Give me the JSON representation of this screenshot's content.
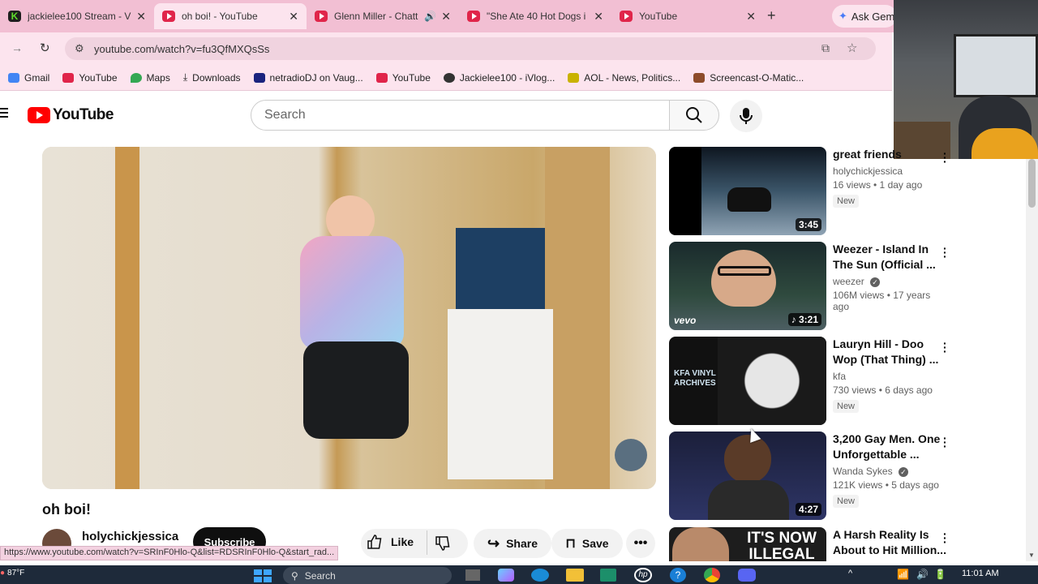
{
  "tabs": [
    {
      "title": "jackielee100 Stream - V",
      "icon": "kick-icon",
      "active": false
    },
    {
      "title": "oh boi! - YouTube",
      "icon": "youtube-icon",
      "active": true
    },
    {
      "title": "Glenn Miller - Chatt",
      "icon": "youtube-icon",
      "active": false
    },
    {
      "title": "\"She Ate 40 Hot Dogs i",
      "icon": "youtube-icon",
      "active": false
    },
    {
      "title": "YouTube",
      "icon": "youtube-icon",
      "active": false
    }
  ],
  "gemini_label": "Ask Gem",
  "url": "youtube.com/watch?v=fu3QfMXQsSs",
  "bookmarks": [
    {
      "label": "Gmail",
      "color": "#4285f4"
    },
    {
      "label": "YouTube",
      "color": "#e0254a"
    },
    {
      "label": "Maps",
      "color": "#34a853"
    },
    {
      "label": "Downloads",
      "color": "#444444"
    },
    {
      "label": "netradioDJ on Vaug...",
      "color": "#1a237e"
    },
    {
      "label": "YouTube",
      "color": "#e0254a"
    },
    {
      "label": "Jackielee100 - iVlog...",
      "color": "#333333"
    },
    {
      "label": "AOL - News, Politics...",
      "color": "#c9b200"
    },
    {
      "label": "Screencast-O-Matic...",
      "color": "#8d4b2a"
    }
  ],
  "youtube": {
    "logo": "YouTube",
    "search_placeholder": "Search"
  },
  "video": {
    "title": "oh boi!",
    "channel": "holychickjessica",
    "subscribe": "Subscribe",
    "like": "Like",
    "share": "Share",
    "save": "Save"
  },
  "recommendations": [
    {
      "title": "great friends",
      "channel": "holychickjessica",
      "meta": "16 views • 1 day ago",
      "badge": "New",
      "duration": "3:45",
      "verified": false
    },
    {
      "title": "Weezer - Island In The Sun (Official ...",
      "channel": "weezer",
      "meta": "106M views • 17 years ago",
      "badge": "",
      "duration": "3:21",
      "verified": true,
      "overlay": "vevo"
    },
    {
      "title": "Lauryn Hill - Doo Wop (That Thing) ...",
      "channel": "kfa",
      "meta": "730 views • 6 days ago",
      "badge": "New",
      "duration": "",
      "verified": false,
      "overlay": "KFA VINYL ARCHIVES"
    },
    {
      "title": "3,200 Gay Men. One Unforgettable ...",
      "channel": "Wanda Sykes",
      "meta": "121K views • 5 days ago",
      "badge": "New",
      "duration": "4:27",
      "verified": true
    },
    {
      "title": "A Harsh Reality Is About to Hit Million...",
      "channel": "",
      "meta": "",
      "badge": "",
      "duration": "",
      "verified": false,
      "overlay": "IT'S NOW ILLEGAL"
    }
  ],
  "status_url": "https://www.youtube.com/watch?v=SRInF0Hlo-Q&list=RDSRInF0Hlo-Q&start_rad...",
  "taskbar": {
    "weather": "87°F",
    "search": "Search",
    "time": "11:01 AM"
  }
}
